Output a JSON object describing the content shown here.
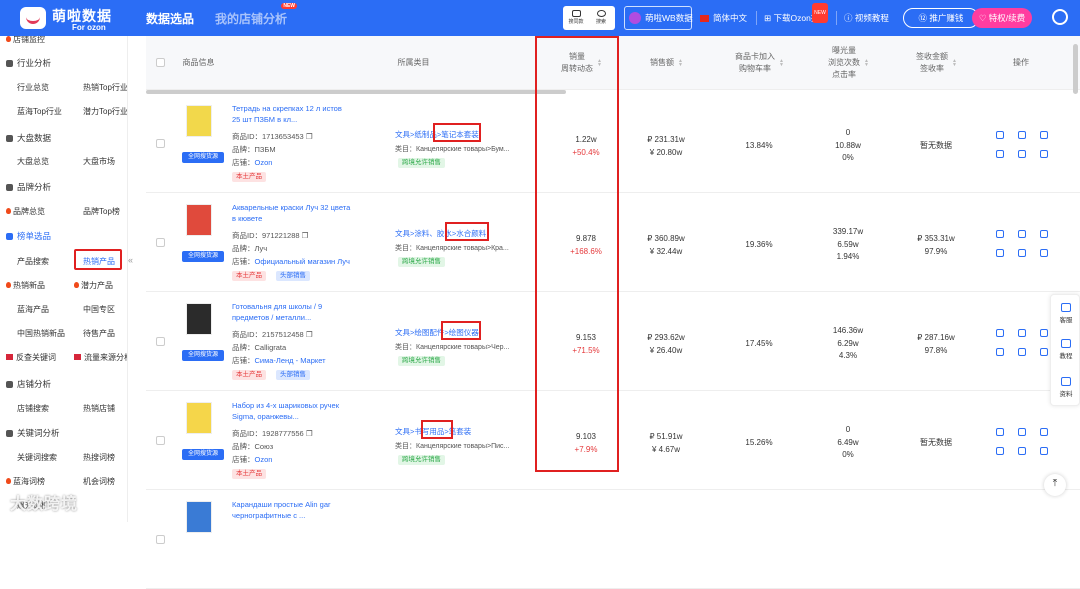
{
  "brand": {
    "title": "萌啦数据",
    "subtitle": "For ozon"
  },
  "nav": {
    "tab1": "数据选品",
    "tab2": "我的店铺分析",
    "new": "NEW"
  },
  "tools": {
    "image_search": "搜同款",
    "search": "搜索"
  },
  "header": {
    "wb": "萌啦WB数据",
    "lang": "简体中文",
    "plugin": "下载Ozon插件",
    "plugin_new": "NEW",
    "video": "视频教程",
    "promo": "推广赚钱",
    "vip": "特权/续费"
  },
  "sidebar": {
    "store_monitor": "店铺监控",
    "industry": "行业分析",
    "industry_overview": "行业总览",
    "hot_top": "热销Top行业",
    "blue_top": "蓝海Top行业",
    "potential_top": "潜力Top行业",
    "market": "大盘数据",
    "market_overview": "大盘总览",
    "market_board": "大盘市场",
    "brand": "品牌分析",
    "brand_overview": "品牌总览",
    "brand_top": "品牌Top榜",
    "rank": "榜单选品",
    "product_search": "产品搜索",
    "hot_product": "热销产品",
    "hot_new": "热销新品",
    "potential_product": "潜力产品",
    "blue_product": "蓝海产品",
    "china_zone": "中国专区",
    "china_hot_new": "中国热销新品",
    "to_sell": "待售产品",
    "reverse_kw": "反查关键词",
    "traffic_source": "流量来源分析",
    "store_analysis": "店铺分析",
    "store_search": "店铺搜索",
    "hot_store": "热销店铺",
    "kw_analysis": "关键词分析",
    "kw_search": "关键词搜索",
    "hot_kw": "热搜词榜",
    "blue_kw": "蓝海词榜",
    "opp_kw": "机会词榜",
    "rise_kw": "飙升词榜"
  },
  "watermark": "大数跨境",
  "table": {
    "headers": {
      "product": "商品信息",
      "category": "所属类目",
      "sales": "销量\n周转动态",
      "amount": "销售额",
      "cart": "商品卡加入\n购物车率",
      "exposure": "曝光量\n浏览次数\n点击率",
      "signed": "签收金额\n签收率",
      "ops": "操作"
    },
    "labels": {
      "id": "商品ID：",
      "brand": "品牌：",
      "store": "店铺：",
      "cat": "类目：",
      "source": "全网搜货源",
      "cross": "跨境允许销售",
      "local": "本土产品",
      "top": "头部销售"
    },
    "rows": [
      {
        "name": "Тетрадь на скрепках 12 л истов 25 шт ПЗБМ в кл...",
        "id": "1713653453",
        "brand": "ПЗБМ",
        "store": "Ozon",
        "cat_a": "文具>",
        "cat_b": "纸制品>",
        "cat_c": "笔记本套装",
        "cat_ru": "Канцелярские товары>Бум...",
        "sales": "1.22w",
        "sales_chg": "+50.4%",
        "amount1": "₽ 231.31w",
        "amount2": "¥ 20.80w",
        "cart": "13.84%",
        "exp1": "0",
        "exp2": "10.88w",
        "exp3": "0%",
        "signed1": "暂无数据",
        "signed2": "",
        "head": false
      },
      {
        "name": "Акварельные краски Луч 32 цвета в кювете",
        "id": "971221288",
        "brand": "Луч",
        "store": "Официальный магазин Луч",
        "cat_a": "文具>",
        "cat_b": "涂料、胶水>",
        "cat_c": "水合颜料",
        "cat_ru": "Канцелярские товары>Кра...",
        "sales": "9.878",
        "sales_chg": "+168.6%",
        "amount1": "₽ 360.89w",
        "amount2": "¥ 32.44w",
        "cart": "19.36%",
        "exp1": "339.17w",
        "exp2": "6.59w",
        "exp3": "1.94%",
        "signed1": "₽ 353.31w",
        "signed2": "97.9%",
        "head": true
      },
      {
        "name": "Готовальня для школы / 9 предметов / металли...",
        "id": "2157512458",
        "brand": "Calligrata",
        "store": "Сима-Ленд - Маркет",
        "cat_a": "文具>",
        "cat_b": "绘图配件>",
        "cat_c": "绘图仪器",
        "cat_ru": "Канцелярские товары>Чер...",
        "sales": "9.153",
        "sales_chg": "+71.5%",
        "amount1": "₽ 293.62w",
        "amount2": "¥ 26.40w",
        "cart": "17.45%",
        "exp1": "146.36w",
        "exp2": "6.29w",
        "exp3": "4.3%",
        "signed1": "₽ 287.16w",
        "signed2": "97.8%",
        "head": true
      },
      {
        "name": "Набор из 4-х шариковых ручек Sigma, оранжевы...",
        "id": "1928777556",
        "brand": "Союз",
        "store": "Ozon",
        "cat_a": "文具>",
        "cat_b": "书写用品>",
        "cat_c": "笔套装",
        "cat_ru": "Канцелярские товары>Пис...",
        "sales": "9.103",
        "sales_chg": "+7.9%",
        "amount1": "₽ 51.91w",
        "amount2": "¥ 4.67w",
        "cart": "15.26%",
        "exp1": "0",
        "exp2": "6.49w",
        "exp3": "0%",
        "signed1": "暂无数据",
        "signed2": "",
        "head": false
      },
      {
        "name": "Карандаши простые Alin gar чернографитные с ..."
      }
    ]
  },
  "float": {
    "service": "客服",
    "tutorial": "教程",
    "material": "资料"
  },
  "colors": {
    "primary": "#2b6df5",
    "highlight": "#e02020",
    "up": "#e5393b"
  }
}
